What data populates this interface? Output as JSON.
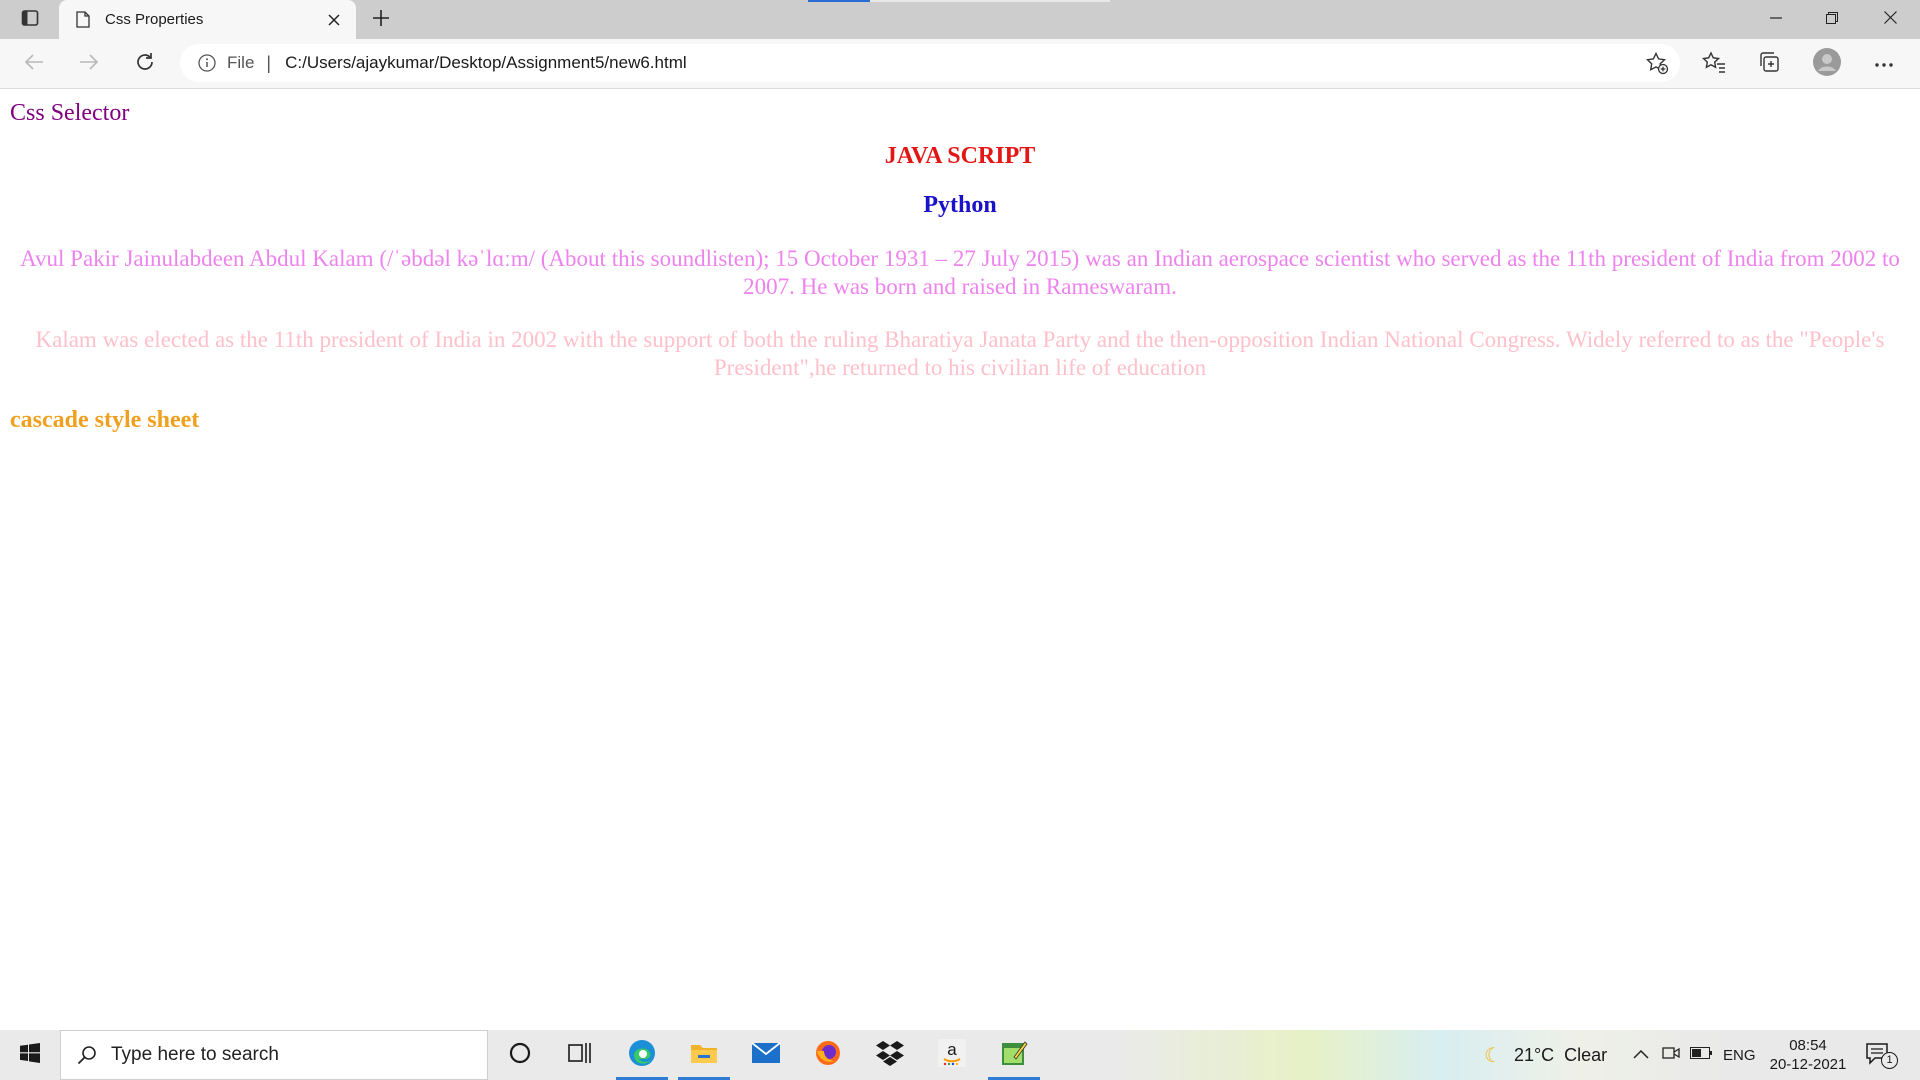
{
  "browser": {
    "tab_title": "Css Properties",
    "address_prefix": "File",
    "address_separator": "|",
    "url": "C:/Users/ajaykumar/Desktop/Assignment5/new6.html"
  },
  "page": {
    "css_selector": "Css Selector",
    "java_heading": "JAVA SCRIPT",
    "python_heading": "Python",
    "paragraph1": "Avul Pakir Jainulabdeen Abdul Kalam (/ˈəbdəl kəˈlɑːm/ (About this soundlisten); 15 October 1931 – 27 July 2015) was an Indian aerospace scientist who served as the 11th president of India from 2002 to 2007. He was born and raised in Rameswaram.",
    "paragraph2": "Kalam was elected as the 11th president of India in 2002 with the support of both the ruling Bharatiya Janata Party and the then-opposition Indian National Congress. Widely referred to as the \"People's President\",he returned to his civilian life of education",
    "cascade": "cascade style sheet"
  },
  "taskbar": {
    "search_placeholder": "Type here to search",
    "weather": "21°C  Clear",
    "language": "ENG",
    "time": "08:54",
    "date": "20-12-2021",
    "notification_count": "1",
    "pinned_apps": [
      "cortana-icon",
      "task-view-icon",
      "edge-icon",
      "file-explorer-icon",
      "mail-icon",
      "firefox-icon",
      "dropbox-icon",
      "amazon-icon",
      "notepad-app-icon"
    ]
  },
  "colors": {
    "css_selector": "#800080",
    "java_heading": "#e31616",
    "python_heading": "#1a12c8",
    "paragraph1": "#ee82ee",
    "paragraph2": "#ffc0cb",
    "cascade": "#f0a01e"
  }
}
